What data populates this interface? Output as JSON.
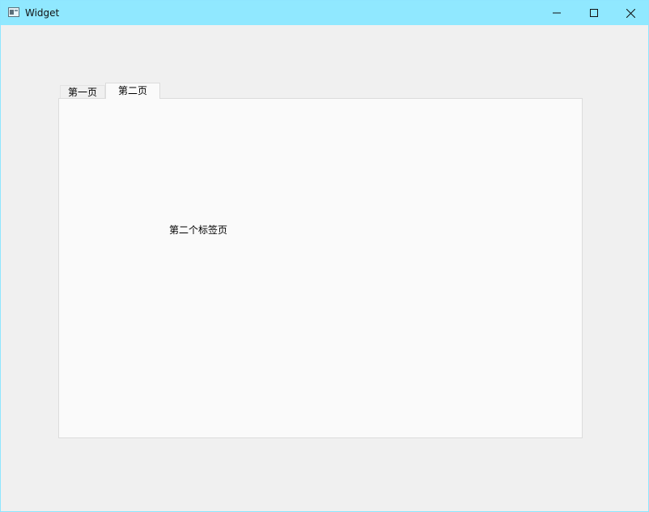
{
  "window": {
    "title": "Widget",
    "titlebar_color": "#90e8ff"
  },
  "titlebar_buttons": {
    "minimize_icon": "minimize-icon",
    "maximize_icon": "maximize-icon",
    "close_icon": "close-icon"
  },
  "tabs": [
    {
      "label": "第一页",
      "selected": false
    },
    {
      "label": "第二页",
      "selected": true
    }
  ],
  "tab_content": {
    "label": "第二个标签页"
  }
}
